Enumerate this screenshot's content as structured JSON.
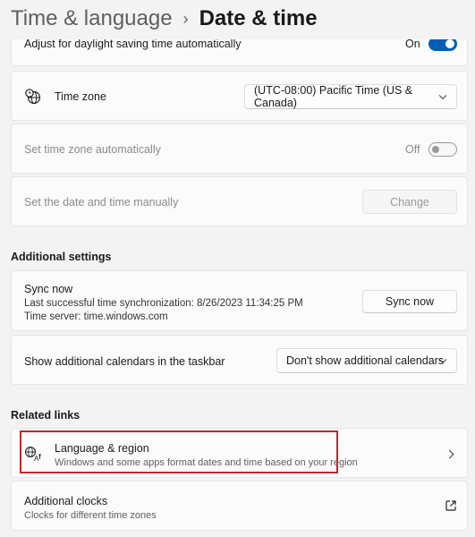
{
  "breadcrumb": {
    "parent": "Time & language",
    "separator": "›",
    "current": "Date & time"
  },
  "settings": {
    "daylight_saving": {
      "label": "Adjust for daylight saving time automatically",
      "state": "On"
    },
    "time_zone": {
      "label": "Time zone",
      "value": "(UTC-08:00) Pacific Time (US & Canada)"
    },
    "auto_time_zone": {
      "label": "Set time zone automatically",
      "state": "Off"
    },
    "manual_datetime": {
      "label": "Set the date and time manually",
      "button": "Change"
    }
  },
  "additional": {
    "title": "Additional settings",
    "sync": {
      "title": "Sync now",
      "last_sync": "Last successful time synchronization: 8/26/2023 11:34:25 PM",
      "server": "Time server: time.windows.com",
      "button": "Sync now"
    },
    "calendars": {
      "label": "Show additional calendars in the taskbar",
      "value": "Don't show additional calendars"
    }
  },
  "related": {
    "title": "Related links",
    "language_region": {
      "title": "Language & region",
      "desc": "Windows and some apps format dates and time based on your region"
    },
    "clocks": {
      "title": "Additional clocks",
      "desc": "Clocks for different time zones"
    }
  },
  "colors": {
    "accent": "#005fb8",
    "highlight_border": "#c0282d"
  },
  "icons": [
    "globe-clock-icon",
    "language-icon",
    "chevron-right-icon",
    "external-link-icon",
    "chevron-down-icon"
  ]
}
